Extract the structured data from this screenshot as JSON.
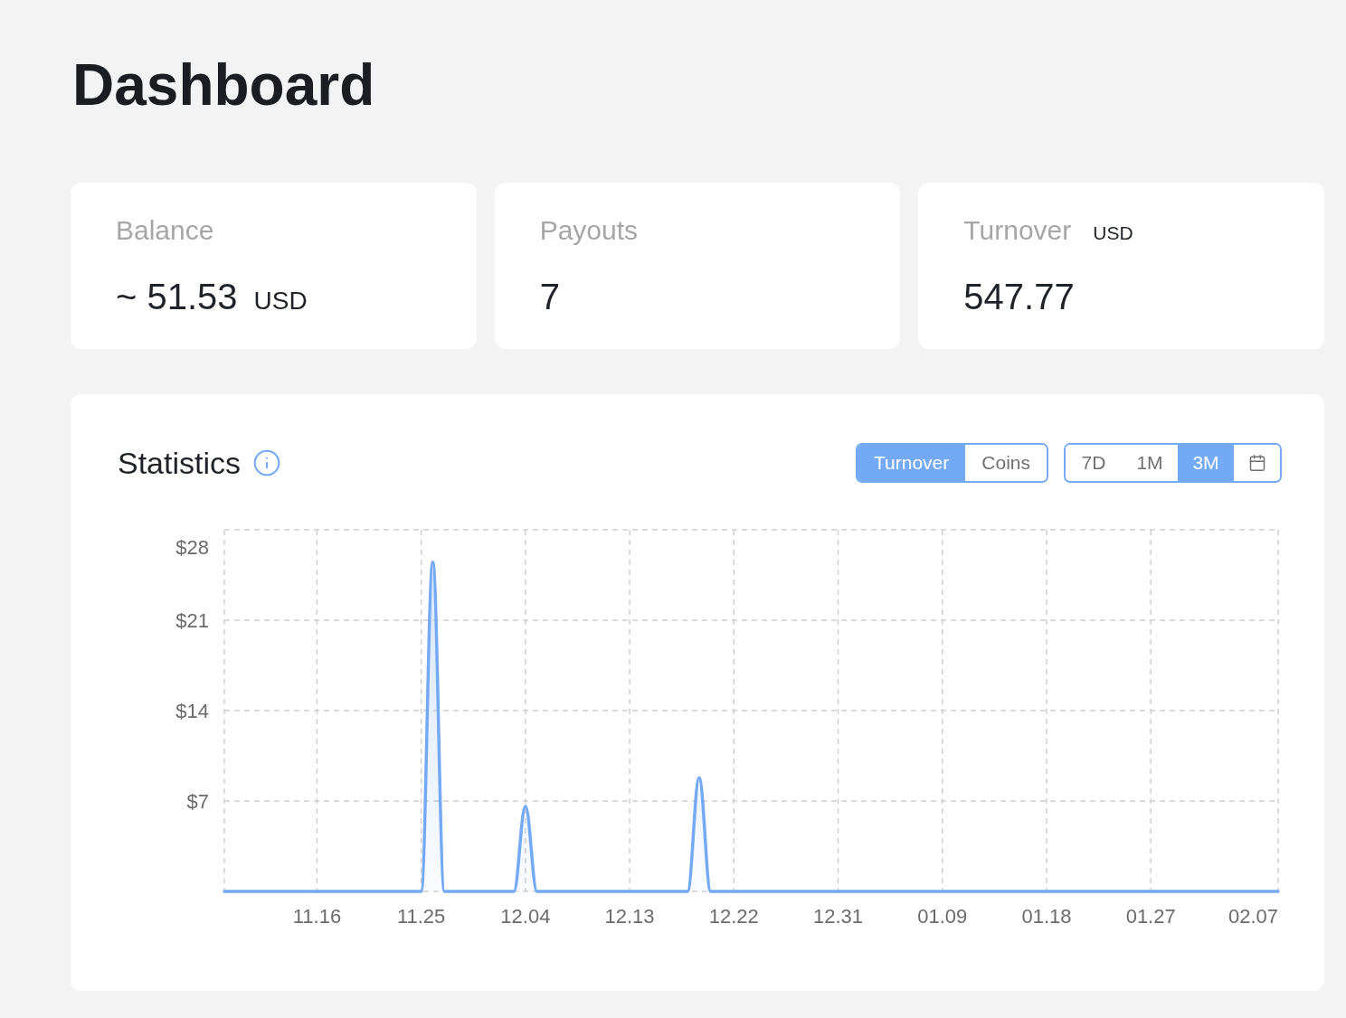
{
  "page": {
    "title": "Dashboard"
  },
  "cards": [
    {
      "label": "Balance",
      "value": "~ 51.53",
      "value_unit": "USD"
    },
    {
      "label": "Payouts",
      "value": "7"
    },
    {
      "label": "Turnover",
      "label_unit": "USD",
      "value": "547.77"
    }
  ],
  "statistics": {
    "title": "Statistics",
    "metrics": [
      {
        "label": "Turnover",
        "selected": true
      },
      {
        "label": "Coins",
        "selected": false
      }
    ],
    "periods": [
      {
        "label": "7D",
        "selected": false
      },
      {
        "label": "1M",
        "selected": false
      },
      {
        "label": "3M",
        "selected": true
      }
    ],
    "chart_data": {
      "type": "area",
      "grid": true,
      "categories": [
        null,
        null,
        null,
        null,
        null,
        null,
        null,
        null,
        "11.16",
        null,
        null,
        null,
        null,
        null,
        null,
        null,
        null,
        "11.25",
        null,
        null,
        null,
        null,
        null,
        null,
        null,
        null,
        "12.04",
        null,
        null,
        null,
        null,
        null,
        null,
        null,
        null,
        "12.13",
        null,
        null,
        null,
        null,
        null,
        null,
        null,
        null,
        "12.22",
        null,
        null,
        null,
        null,
        null,
        null,
        null,
        null,
        "12.31",
        null,
        null,
        null,
        null,
        null,
        null,
        null,
        null,
        "01.09",
        null,
        null,
        null,
        null,
        null,
        null,
        null,
        null,
        "01.18",
        null,
        null,
        null,
        null,
        null,
        null,
        null,
        null,
        "01.27",
        null,
        null,
        null,
        null,
        null,
        null,
        null,
        null,
        null,
        null,
        "02.07"
      ],
      "series": [
        {
          "color": "#74a9f5",
          "values": [
            0,
            0,
            0,
            0,
            0,
            0,
            0,
            0,
            0,
            0,
            0,
            0,
            0,
            0,
            0,
            0,
            0,
            0,
            25.5,
            0,
            0,
            0,
            0,
            0,
            0,
            0,
            6.6,
            0,
            0,
            0,
            0,
            0,
            0,
            0,
            0,
            0,
            0,
            0,
            0,
            0,
            0,
            8.8,
            0,
            0,
            0,
            0,
            0,
            0,
            0,
            0,
            0,
            0,
            0,
            0,
            0,
            0,
            0,
            0,
            0,
            0,
            0,
            0,
            0,
            0,
            0,
            0,
            0,
            0,
            0,
            0,
            0,
            0,
            0,
            0,
            0,
            0,
            0,
            0,
            0,
            0,
            0,
            0,
            0,
            0,
            0,
            0,
            0,
            0,
            0,
            0,
            0,
            0
          ]
        }
      ],
      "ylim": [
        0,
        28
      ],
      "yticks": [
        {
          "value": 7,
          "label": "$7"
        },
        {
          "value": 14,
          "label": "$14"
        },
        {
          "value": 21,
          "label": "$21"
        },
        {
          "value": 28,
          "label": "$28"
        }
      ]
    }
  }
}
